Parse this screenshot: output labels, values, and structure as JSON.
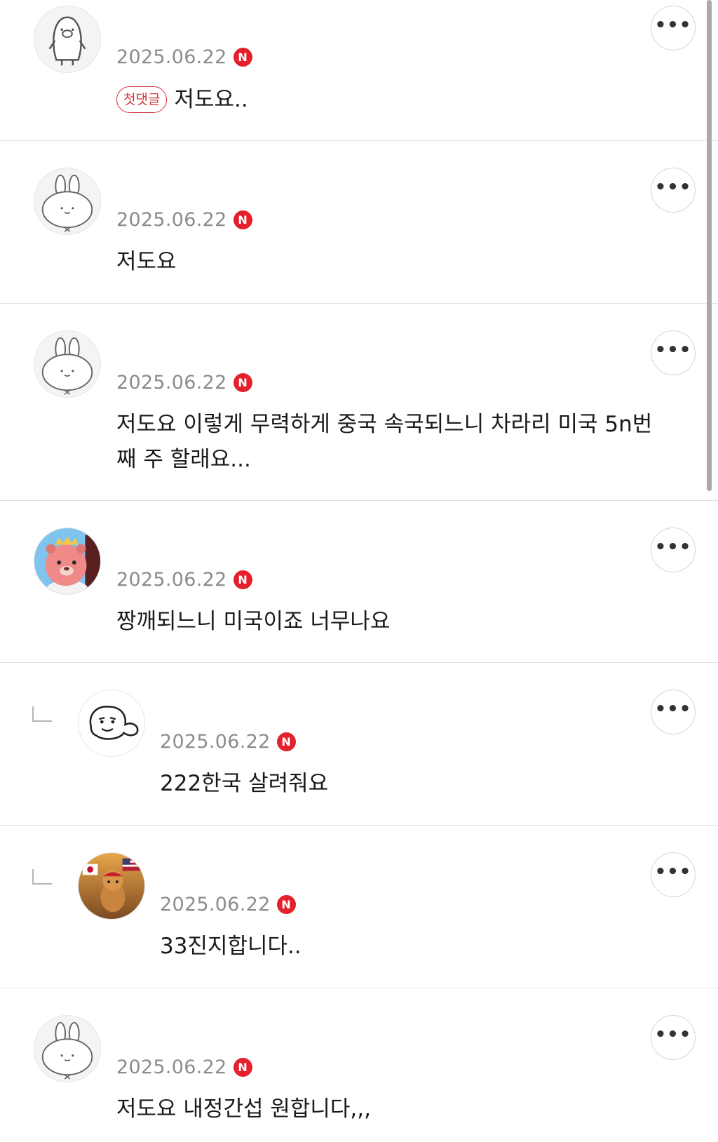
{
  "comments": [
    {
      "date": "2025.06.22",
      "badge_n": "N",
      "first_badge": "첫댓글",
      "text": "저도요..",
      "more": "•••",
      "avatar": "penguin-avatar"
    },
    {
      "date": "2025.06.22",
      "badge_n": "N",
      "text": "저도요",
      "more": "•••",
      "avatar": "rabbit-avatar"
    },
    {
      "date": "2025.06.22",
      "badge_n": "N",
      "text": "저도요 이렇게 무력하게 중국 속국되느니 차라리 미국 5n번째 주 할래요...",
      "more": "•••",
      "avatar": "rabbit-avatar"
    },
    {
      "date": "2025.06.22",
      "badge_n": "N",
      "text": "짱깨되느니 미국이죠 너무나요",
      "more": "•••",
      "avatar": "beaver-avatar"
    },
    {
      "date": "2025.06.22",
      "badge_n": "N",
      "text": "222한국 살려줘요",
      "more": "•••",
      "avatar": "doodle-avatar",
      "reply": true
    },
    {
      "date": "2025.06.22",
      "badge_n": "N",
      "text": "33진지합니다..",
      "more": "•••",
      "avatar": "cat-flag-avatar",
      "reply": true
    },
    {
      "date": "2025.06.22",
      "badge_n": "N",
      "text": "저도요 내정간섭 원합니다,,,",
      "more": "•••",
      "avatar": "rabbit-avatar"
    }
  ]
}
